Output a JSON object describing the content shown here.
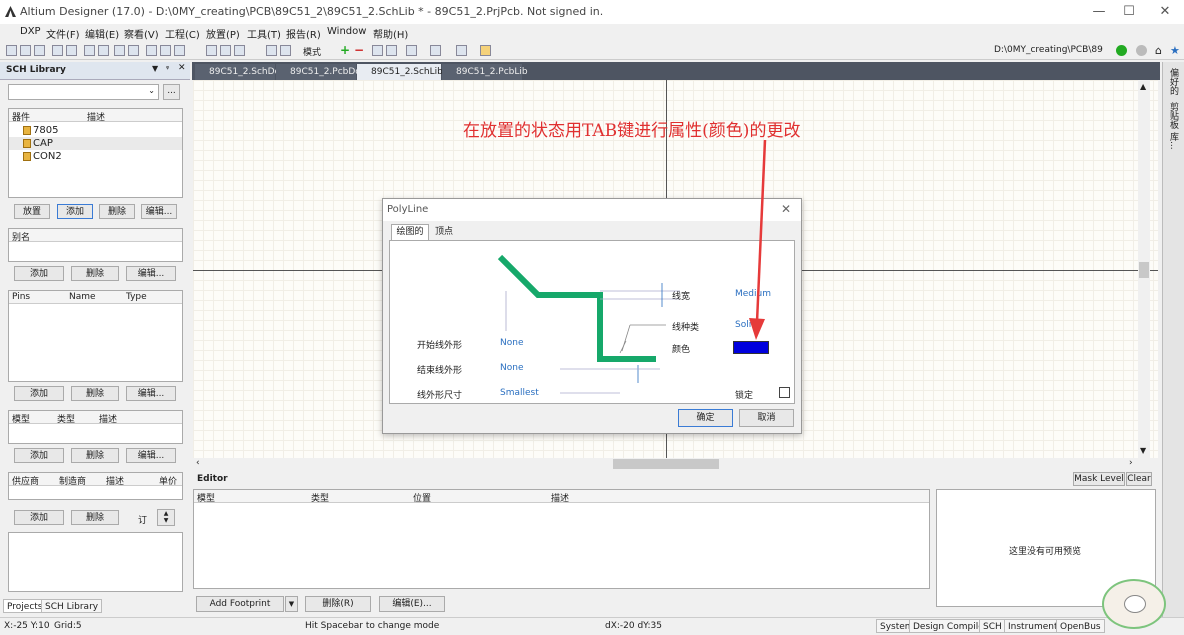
{
  "window": {
    "title": "Altium Designer (17.0) - D:\\0MY_creating\\PCB\\89C51_2\\89C51_2.SchLib * - 89C51_2.PrjPcb. Not signed in."
  },
  "menu": [
    "DXP",
    "文件(F)",
    "编辑(E)",
    "察看(V)",
    "工程(C)",
    "放置(P)",
    "工具(T)",
    "报告(R)",
    "Window",
    "帮助(H)"
  ],
  "toolbar": {
    "mode_label": "模式",
    "path": "D:\\0MY_creating\\PCB\\89"
  },
  "sch_panel": {
    "title": "SCH Library",
    "components_header": [
      "器件",
      "描述"
    ],
    "components": [
      "7805",
      "CAP",
      "CON2"
    ],
    "comp_buttons": [
      "放置",
      "添加",
      "删除",
      "编辑..."
    ],
    "alias_header": "别名",
    "alias_buttons": [
      "添加",
      "删除",
      "编辑..."
    ],
    "pins_header": [
      "Pins",
      "Name",
      "Type"
    ],
    "pins_buttons": [
      "添加",
      "删除",
      "编辑..."
    ],
    "model_header": [
      "模型",
      "类型",
      "描述"
    ],
    "model_buttons": [
      "添加",
      "删除",
      "编辑..."
    ],
    "supplier_header": [
      "供应商",
      "制造商",
      "描述",
      "单价"
    ],
    "supplier_buttons": [
      "添加",
      "删除"
    ],
    "order_label": "订",
    "bottom_tabs": [
      "Projects",
      "SCH Library"
    ]
  },
  "doc_tabs": [
    "89C51_2.SchDoc",
    "89C51_2.PcbDoc",
    "89C51_2.SchLib *",
    "89C51_2.PcbLib"
  ],
  "right_tabs": [
    "偏好的",
    "剪贴板",
    "库..."
  ],
  "annotation": "在放置的状态用TAB键进行属性(颜色)的更改",
  "dialog": {
    "title": "PolyLine",
    "tabs": [
      "绘图的",
      "顶点"
    ],
    "labels": {
      "line_width": "线宽",
      "line_kind": "线种类",
      "color": "颜色",
      "start_shape": "开始线外形",
      "end_shape": "结束线外形",
      "shape_size": "线外形尺寸",
      "lock": "锁定"
    },
    "values": {
      "line_width": "Medium",
      "line_kind": "Solid",
      "start_shape": "None",
      "end_shape": "None",
      "shape_size": "Smallest"
    },
    "color": "#0000dd",
    "ok": "确定",
    "cancel": "取消"
  },
  "editor": {
    "title": "Editor",
    "mask_level": "Mask Level",
    "clear": "Clear",
    "columns": [
      "模型",
      "类型",
      "位置",
      "描述"
    ],
    "preview_text": "这里没有可用预览",
    "buttons": [
      "Add Footprint",
      "删除(R)",
      "编辑(E)..."
    ]
  },
  "status": {
    "coords": "X:-25 Y:10",
    "grid": "Grid:5",
    "hint": "Hit Spacebar to change mode",
    "delta": "dX:-20 dY:35",
    "tabs": [
      "System",
      "Design Compiler",
      "SCH",
      "Instruments",
      "OpenBus"
    ]
  },
  "colors": {
    "polyline_green": "#16a86a",
    "arrow_red": "#e63a3a",
    "annotation_red": "#e03030",
    "tab_dark": "#5a6270",
    "tab_active": "#e8ecf2"
  }
}
